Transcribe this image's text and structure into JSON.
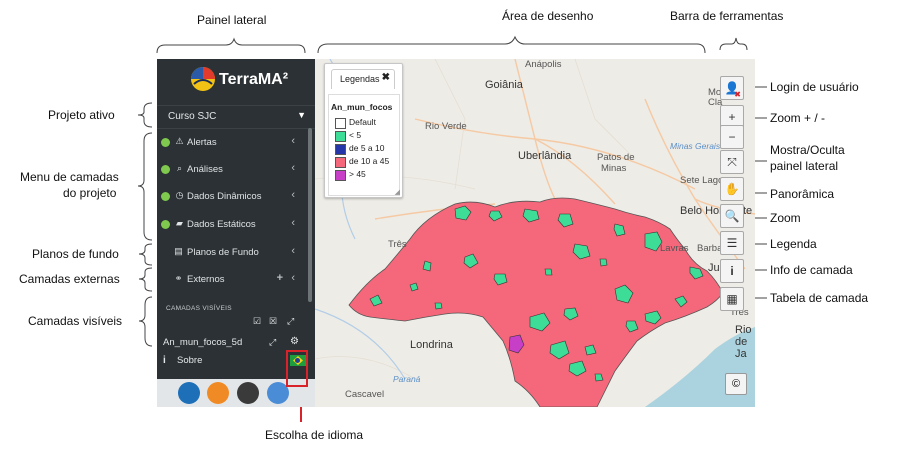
{
  "annotations": {
    "painel_lateral": "Painel lateral",
    "area_desenho": "Área de desenho",
    "barra_ferramentas": "Barra de ferramentas",
    "projeto_ativo": "Projeto  ativo",
    "menu_camadas_1": "Menu de camadas",
    "menu_camadas_2": "do projeto",
    "planos_fundo": "Planos de fundo",
    "camadas_externas": "Camadas externas",
    "camadas_visiveis": "Camadas visíveis",
    "escolha_idioma": "Escolha de idioma",
    "login_usuario": "Login de usuário",
    "zoom_mais_menos": "Zoom  + / -",
    "mostra_oculta_1": "Mostra/Oculta",
    "mostra_oculta_2": "painel lateral",
    "panoramica": "Panorâmica",
    "zoom": "Zoom",
    "legenda": "Legenda",
    "info_camada": "Info de camada",
    "tabela_camada": "Tabela de camada"
  },
  "sidebar": {
    "brand": "TerraMA²",
    "project": "Curso SJC",
    "menu": [
      {
        "label": "Alertas",
        "icon": "warning-icon"
      },
      {
        "label": "Análises",
        "icon": "search-icon"
      },
      {
        "label": "Dados Dinâmicos",
        "icon": "clock-icon"
      },
      {
        "label": "Dados Estáticos",
        "icon": "folder-icon"
      }
    ],
    "planos_fundo": "Planos de Fundo",
    "externos": "Externos",
    "visible_header": "CAMADAS VISÍVEIS",
    "visible_layer": "An_mun_focos_5d",
    "about": "Sobre",
    "about_icon": "i",
    "language_flag": "brazil-flag-icon"
  },
  "map": {
    "legend": {
      "tab_title": "Legendas",
      "layer_name": "An_mun_focos",
      "items": [
        {
          "label": "Default",
          "color": "#ffffff"
        },
        {
          "label": "< 5",
          "color": "#3ddc97"
        },
        {
          "label": "de 5 a 10",
          "color": "#2536a8"
        },
        {
          "label": "de 10 a 45",
          "color": "#f5677a"
        },
        {
          "label": "> 45",
          "color": "#c63fc6"
        }
      ]
    },
    "cities": {
      "anapolis": "Anápolis",
      "goiania": "Goiânia",
      "rio_verde": "Rio Verde",
      "uberlandia": "Uberlândia",
      "patos_1": "Patos de",
      "patos_2": "Minas",
      "minas_gerais": "Minas Gerais",
      "sete_lagoas": "Sete Lagoas",
      "belo_horizonte": "Belo Horizonte",
      "lavras": "Lavras",
      "barba": "Barba",
      "juiz_de_fora": "Ju    Fo",
      "tres": "Três",
      "londrina": "Londrina",
      "rio_de_janeiro": "Rio de Ja",
      "cascavel": "Cascavel",
      "parana": "Paraná",
      "cla": "Cla",
      "mon": "Mon",
      "tres_rios": "Três"
    },
    "copyright": "©"
  },
  "colors": {
    "sidebar_bg": "#2b3134",
    "state_fill": "#f5677a",
    "focus_green": "#3ddc97",
    "focus_purple": "#c63fc6",
    "status_dot": "#7ec94e"
  }
}
